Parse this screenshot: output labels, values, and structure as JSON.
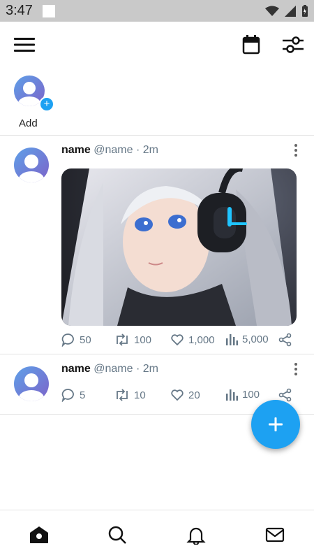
{
  "status_bar": {
    "time": "3:47"
  },
  "stories": {
    "add_label": "Add"
  },
  "posts": [
    {
      "name": "name",
      "handle": "@name",
      "separator": "·",
      "time": "2m",
      "has_image": true,
      "stats": {
        "replies": "50",
        "retweets": "100",
        "likes": "1,000",
        "views": "5,000"
      }
    },
    {
      "name": "name",
      "handle": "@name",
      "separator": "·",
      "time": "2m",
      "has_image": false,
      "stats": {
        "replies": "5",
        "retweets": "10",
        "likes": "20",
        "views": "100"
      }
    }
  ],
  "icons": {
    "menu": "hamburger-menu-icon",
    "calendar": "calendar-icon",
    "filters": "sliders-icon",
    "home": "home-icon",
    "search": "search-icon",
    "notifications": "bell-icon",
    "messages": "mail-icon",
    "compose": "plus-icon"
  },
  "colors": {
    "accent": "#1da1f2",
    "muted": "#657786",
    "status_bar": "#c9c9c9"
  }
}
